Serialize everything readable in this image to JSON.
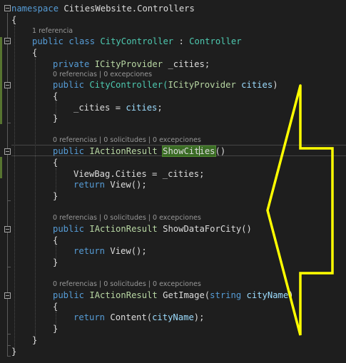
{
  "editor": {
    "lines": {
      "l1": {
        "kw": "namespace",
        "name": "CitiesWebsite.Controllers"
      },
      "l2": {
        "text": "{"
      },
      "lens1": {
        "text": "1 referencia"
      },
      "l3": {
        "kw1": "public",
        "kw2": "class",
        "type": "CityController",
        "colon": " : ",
        "base": "Controller"
      },
      "l4": {
        "text": "{"
      },
      "l5": {
        "kw": "private",
        "iface": "ICityProvider",
        "field": "_cities;"
      },
      "lens2": {
        "text": "0 referencias | 0 excepciones"
      },
      "l6": {
        "kw": "public",
        "name": "CityController(",
        "iface": "ICityProvider",
        "param": "cities",
        "close": ")"
      },
      "l7": {
        "text": "{"
      },
      "l8": {
        "field": "_cities = ",
        "param": "cities",
        "end": ";"
      },
      "l9": {
        "text": "}"
      },
      "lens3": {
        "text": "0 referencias | 0 solicitudes | 0 excepciones"
      },
      "l10": {
        "kw": "public",
        "iface": "IActionResult",
        "name_a": "ShowCit",
        "name_b": "ies",
        "close": "()"
      },
      "l11": {
        "text": "{"
      },
      "l12": {
        "text": "ViewBag.Cities = _cities;"
      },
      "l13": {
        "kw": "return",
        "call": "View();"
      },
      "l14": {
        "text": "}"
      },
      "lens4": {
        "text": "0 referencias | 0 solicitudes | 0 excepciones"
      },
      "l15": {
        "kw": "public",
        "iface": "IActionResult",
        "name": "ShowDataForCity()"
      },
      "l16": {
        "text": "{"
      },
      "l17": {
        "kw": "return",
        "call": "View();"
      },
      "l18": {
        "text": "}"
      },
      "lens5": {
        "text": "0 referencias | 0 solicitudes | 0 excepciones"
      },
      "l19": {
        "kw": "public",
        "iface": "IActionResult",
        "name": "GetImage(",
        "ptype": "string",
        "param": "cityName",
        "close": ")"
      },
      "l20": {
        "text": "{"
      },
      "l21": {
        "kw": "return",
        "call": "Content(",
        "param": "cityName",
        "end": ");"
      },
      "l22": {
        "text": "}"
      },
      "l23": {
        "text": "}"
      },
      "l24": {
        "text": "}"
      }
    },
    "colors": {
      "background": "#1e1e1e",
      "keyword": "#569cd6",
      "type": "#4ec9b0",
      "interface": "#b8d7a3",
      "parameter": "#9cdcfe",
      "annotation_arrow": "#ffff00",
      "change_bar": "#577430"
    },
    "annotation": {
      "shape": "arrow-pointing-left-icon"
    }
  }
}
